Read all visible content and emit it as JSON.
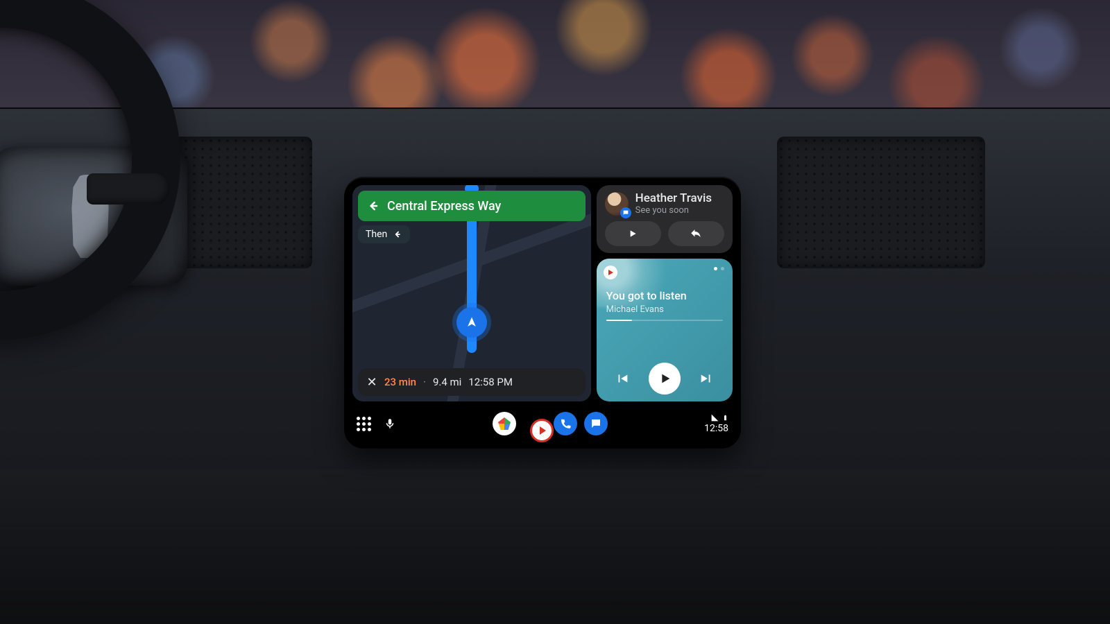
{
  "navigation": {
    "direction_label": "Central Express Way",
    "then_label": "Then",
    "eta_minutes": "23 min",
    "distance": "9.4 mi",
    "arrival_time": "12:58 PM"
  },
  "notification": {
    "sender": "Heather Travis",
    "preview": "See you soon"
  },
  "media": {
    "track_title": "You got to listen",
    "artist": "Michael Evans"
  },
  "status": {
    "clock": "12:58"
  }
}
